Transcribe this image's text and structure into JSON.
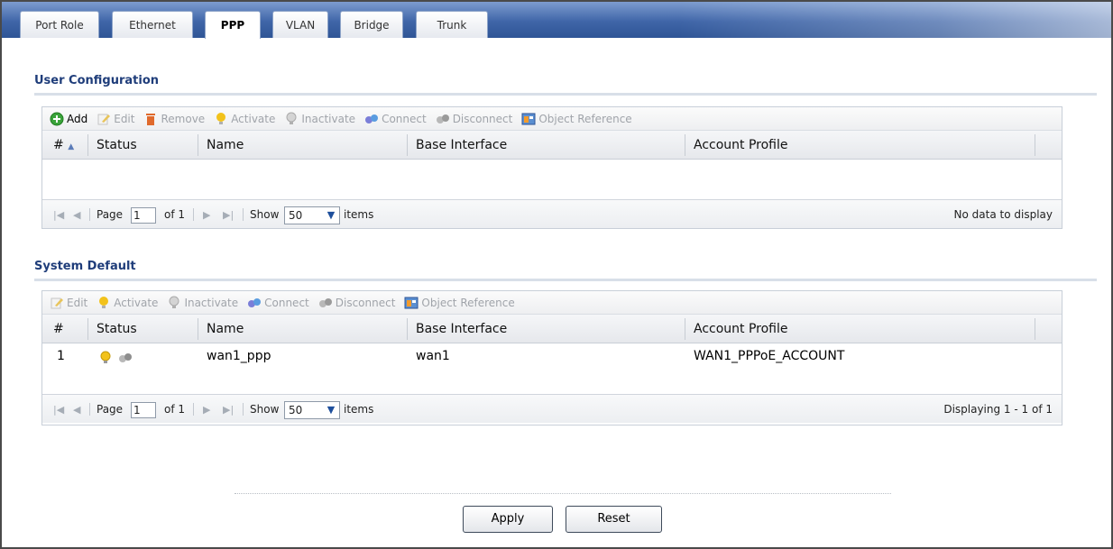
{
  "tabs": [
    {
      "label": "Port Role"
    },
    {
      "label": "Ethernet"
    },
    {
      "label": "PPP"
    },
    {
      "label": "VLAN"
    },
    {
      "label": "Bridge"
    },
    {
      "label": "Trunk"
    }
  ],
  "user_config": {
    "title": "User Configuration",
    "toolbar": {
      "add": "Add",
      "edit": "Edit",
      "remove": "Remove",
      "activate": "Activate",
      "inactivate": "Inactivate",
      "connect": "Connect",
      "disconnect": "Disconnect",
      "object_reference": "Object Reference"
    },
    "columns": {
      "num": "#",
      "status": "Status",
      "name": "Name",
      "base_interface": "Base Interface",
      "account_profile": "Account Profile"
    },
    "sort_indicator": "▲",
    "pager": {
      "page_label": "Page",
      "page_value": "1",
      "of_label": "of 1",
      "show_label": "Show",
      "show_value": "50",
      "items_label": "items",
      "status": "No data to display"
    }
  },
  "system_default": {
    "title": "System Default",
    "toolbar": {
      "edit": "Edit",
      "activate": "Activate",
      "inactivate": "Inactivate",
      "connect": "Connect",
      "disconnect": "Disconnect",
      "object_reference": "Object Reference"
    },
    "columns": {
      "num": "#",
      "status": "Status",
      "name": "Name",
      "base_interface": "Base Interface",
      "account_profile": "Account Profile"
    },
    "rows": [
      {
        "num": "1",
        "status_icons": [
          "bulb-icon",
          "disconnected-icon"
        ],
        "name": "wan1_ppp",
        "base_interface": "wan1",
        "account_profile": "WAN1_PPPoE_ACCOUNT"
      }
    ],
    "pager": {
      "page_label": "Page",
      "page_value": "1",
      "of_label": "of 1",
      "show_label": "Show",
      "show_value": "50",
      "items_label": "items",
      "status": "Displaying 1 - 1 of 1"
    }
  },
  "buttons": {
    "apply": "Apply",
    "reset": "Reset"
  },
  "colors": {
    "tabbar": "#3f65a8",
    "section_title": "#1f3d7a",
    "bulb": "#f2c21b",
    "add_green": "#3aa33a",
    "remove_orange": "#e06a2c"
  }
}
